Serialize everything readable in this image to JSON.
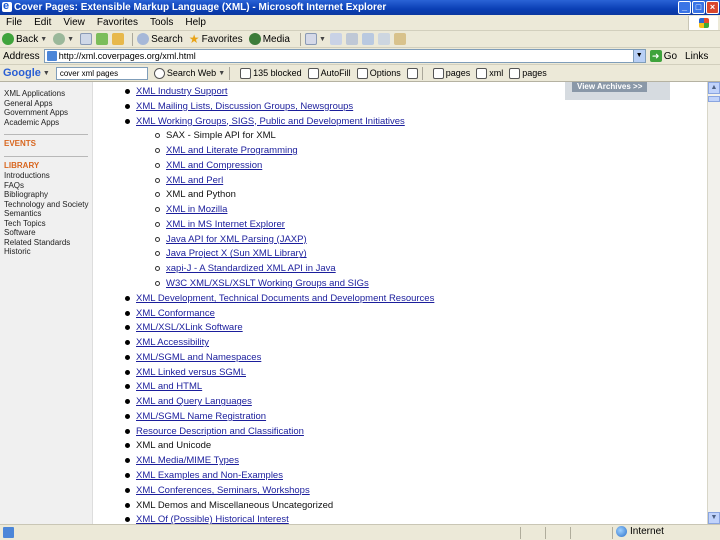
{
  "window": {
    "title": "Cover Pages: Extensible Markup Language (XML) - Microsoft Internet Explorer"
  },
  "menu": [
    "File",
    "Edit",
    "View",
    "Favorites",
    "Tools",
    "Help"
  ],
  "toolbar": {
    "back": "Back",
    "search": "Search",
    "favorites": "Favorites",
    "media": "Media"
  },
  "address": {
    "label": "Address",
    "url": "http://xml.coverpages.org/xml.html",
    "go": "Go",
    "links": "Links"
  },
  "google": {
    "logo": "Google",
    "query": "cover xml pages",
    "search_web": "Search Web",
    "blocked": "135 blocked",
    "autofill": "AutoFill",
    "options": "Options",
    "b1": "pages",
    "b2": "xml",
    "b3": "pages"
  },
  "sidebar": {
    "top_items": [
      "XML Applications",
      "General Apps",
      "Government Apps",
      "Academic Apps"
    ],
    "events": "EVENTS",
    "library_head": "LIBRARY",
    "library_items": [
      "Introductions",
      "FAQs",
      "Bibliography",
      "Technology and Society",
      "Semantics",
      "Tech Topics",
      "Software",
      "Related Standards",
      "Historic"
    ]
  },
  "archives": {
    "label": "View Archives >>"
  },
  "main_list": [
    {
      "text": "XML Industry Support",
      "link": true,
      "level": 1
    },
    {
      "text": "XML Mailing Lists, Discussion Groups, Newsgroups",
      "link": true,
      "level": 1
    },
    {
      "text": "XML Working Groups, SIGS, Public and Development Initiatives",
      "link": true,
      "level": 1
    },
    {
      "text": "SAX - Simple API for XML",
      "link": false,
      "level": 2
    },
    {
      "text": "XML and Literate Programming",
      "link": true,
      "level": 2
    },
    {
      "text": "XML and Compression",
      "link": true,
      "level": 2
    },
    {
      "text": "XML and Perl",
      "link": true,
      "level": 2
    },
    {
      "text": "XML and Python",
      "link": false,
      "level": 2
    },
    {
      "text": "XML in Mozilla",
      "link": true,
      "level": 2
    },
    {
      "text": "XML in MS Internet Explorer",
      "link": true,
      "level": 2
    },
    {
      "text": "Java API for XML Parsing (JAXP)",
      "link": true,
      "level": 2
    },
    {
      "text": "Java Project X (Sun XML Library)",
      "link": true,
      "level": 2
    },
    {
      "text": "xapi-J - A Standardized XML API in Java",
      "link": true,
      "level": 2
    },
    {
      "text": "W3C XML/XSL/XSLT Working Groups and SIGs",
      "link": true,
      "level": 2
    },
    {
      "text": "XML Development, Technical Documents and Development Resources",
      "link": true,
      "level": 1
    },
    {
      "text": "XML Conformance",
      "link": true,
      "level": 1
    },
    {
      "text": "XML/XSL/XLink Software",
      "link": true,
      "level": 1
    },
    {
      "text": "XML Accessibility",
      "link": true,
      "level": 1
    },
    {
      "text": "XML/SGML and Namespaces",
      "link": true,
      "level": 1
    },
    {
      "text": "XML Linked versus SGML",
      "link": true,
      "level": 1
    },
    {
      "text": "XML and HTML",
      "link": true,
      "level": 1
    },
    {
      "text": "XML and Query Languages",
      "link": true,
      "level": 1
    },
    {
      "text": "XML/SGML Name Registration",
      "link": true,
      "level": 1
    },
    {
      "text": "Resource Description and Classification",
      "link": true,
      "level": 1
    },
    {
      "text": "XML and Unicode",
      "link": false,
      "level": 1
    },
    {
      "text": "XML Media/MIME Types",
      "link": true,
      "level": 1
    },
    {
      "text": "XML Examples and Non-Examples",
      "link": true,
      "level": 1
    },
    {
      "text": "XML Conferences, Seminars, Workshops",
      "link": true,
      "level": 1
    },
    {
      "text": "XML Demos and Miscellaneous Uncategorized",
      "link": false,
      "level": 1
    },
    {
      "text": "XML Of (Possible) Historical Interest",
      "link": true,
      "level": 1
    }
  ],
  "status": {
    "zone": "Internet"
  }
}
